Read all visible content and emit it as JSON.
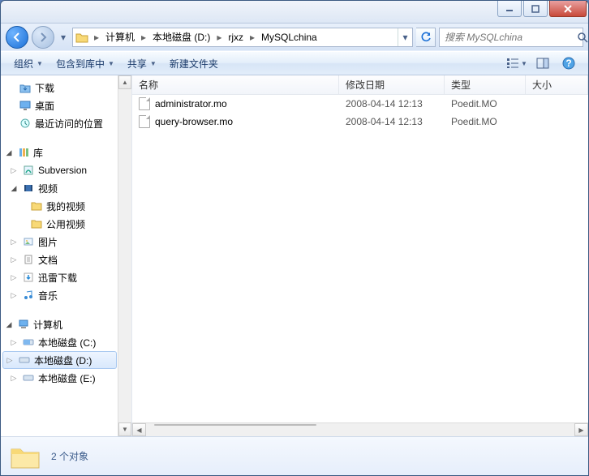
{
  "titlebar": {
    "min_tip": "Minimize",
    "max_tip": "Maximize",
    "close_tip": "Close"
  },
  "nav": {
    "back_tip": "Back",
    "forward_tip": "Forward",
    "refresh_tip": "Refresh"
  },
  "breadcrumb": {
    "segments": [
      "计算机",
      "本地磁盘 (D:)",
      "rjxz",
      "MySQLchina"
    ]
  },
  "search": {
    "placeholder": "搜索 MySQLchina"
  },
  "toolbar": {
    "organize": "组织",
    "include": "包含到库中",
    "share": "共享",
    "newfolder": "新建文件夹",
    "view_tip": "Change view",
    "preview_tip": "Preview pane",
    "help_tip": "Help"
  },
  "tree": {
    "downloads": "下载",
    "desktop": "桌面",
    "recent": "最近访问的位置",
    "libraries": "库",
    "subversion": "Subversion",
    "videos": "视频",
    "my_videos": "我的视频",
    "public_videos": "公用视频",
    "pictures": "图片",
    "documents": "文档",
    "xunlei": "迅雷下载",
    "music": "音乐",
    "computer": "计算机",
    "drive_c": "本地磁盘 (C:)",
    "drive_d": "本地磁盘 (D:)",
    "drive_e": "本地磁盘 (E:)"
  },
  "columns": {
    "name": "名称",
    "date": "修改日期",
    "type": "类型",
    "size": "大小"
  },
  "files": [
    {
      "name": "administrator.mo",
      "date": "2008-04-14 12:13",
      "type": "Poedit.MO"
    },
    {
      "name": "query-browser.mo",
      "date": "2008-04-14 12:13",
      "type": "Poedit.MO"
    }
  ],
  "status": {
    "count_label": "2 个对象"
  }
}
